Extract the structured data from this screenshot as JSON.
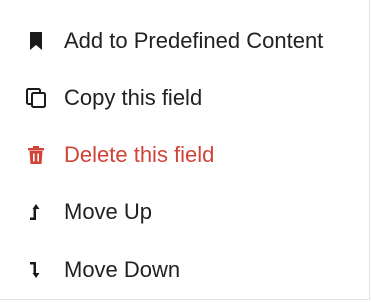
{
  "menu": {
    "items": [
      {
        "label": "Add to Predefined Content",
        "icon": "bookmark-icon"
      },
      {
        "label": "Copy this field",
        "icon": "copy-icon"
      },
      {
        "label": "Delete this field",
        "icon": "trash-icon",
        "color": "#d04437"
      },
      {
        "label": "Move Up",
        "icon": "arrow-up-icon"
      },
      {
        "label": "Move Down",
        "icon": "arrow-down-icon"
      }
    ]
  }
}
